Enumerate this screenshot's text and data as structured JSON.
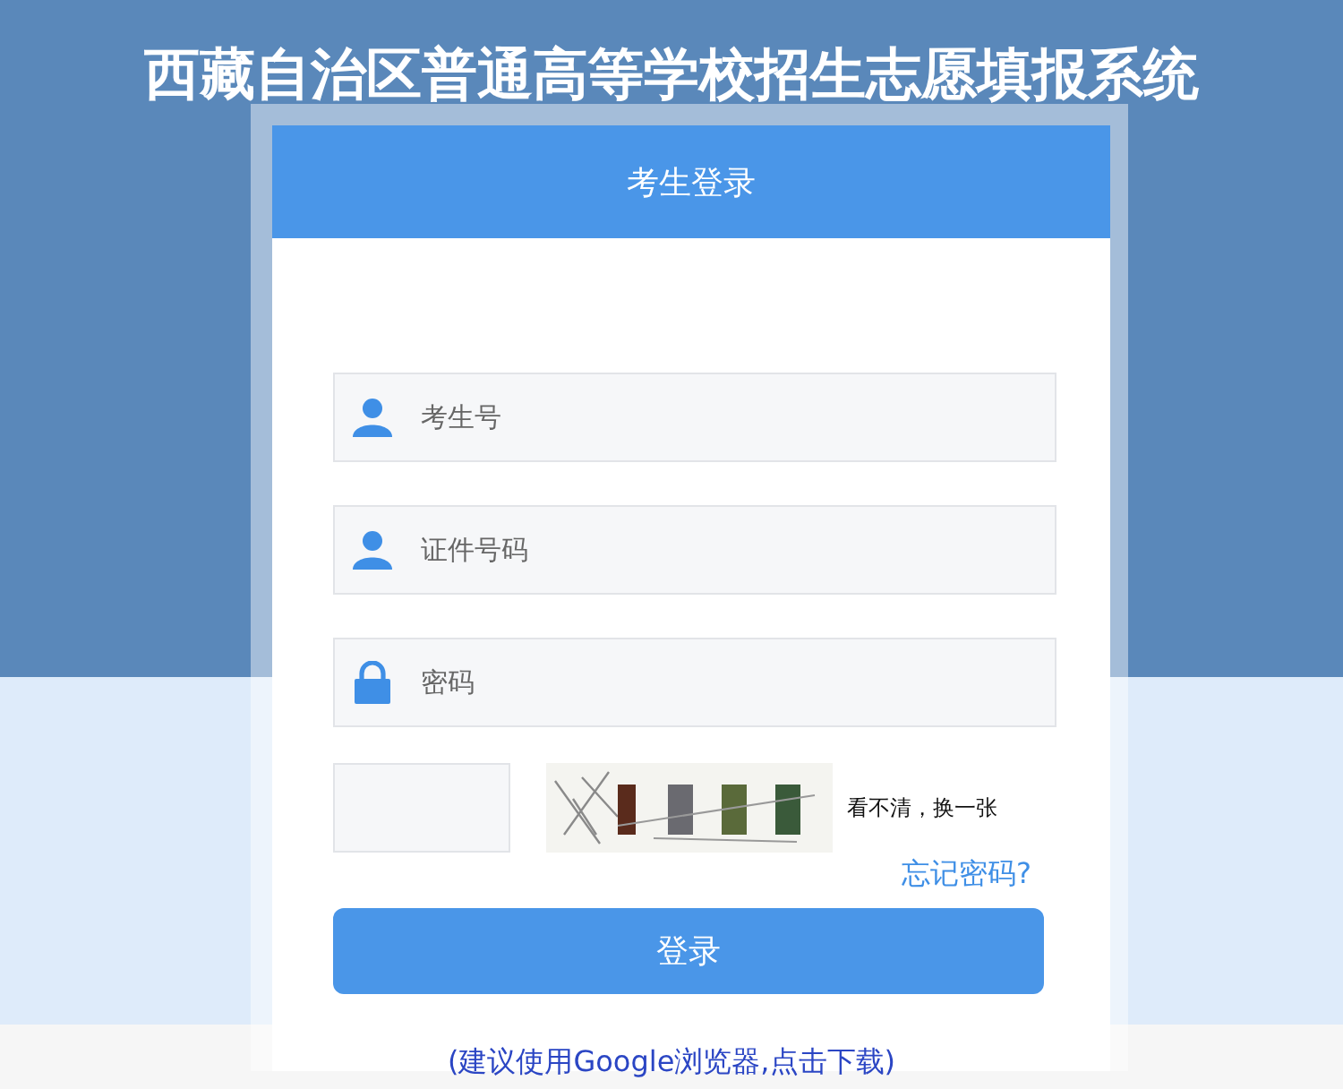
{
  "title": "西藏自治区普通高等学校招生志愿填报系统",
  "login": {
    "header": "考生登录",
    "fields": [
      {
        "kind": "user",
        "placeholder": "考生号"
      },
      {
        "kind": "user",
        "placeholder": "证件号码"
      },
      {
        "kind": "lock",
        "placeholder": "密码"
      }
    ],
    "captcha": {
      "kind": "picture",
      "refresh_link": "看不清，换一张"
    },
    "forgot_link": "忘记密码?",
    "login_button": "登录"
  },
  "footer_link": "(建议使用Google浏览器,点击下载)"
}
